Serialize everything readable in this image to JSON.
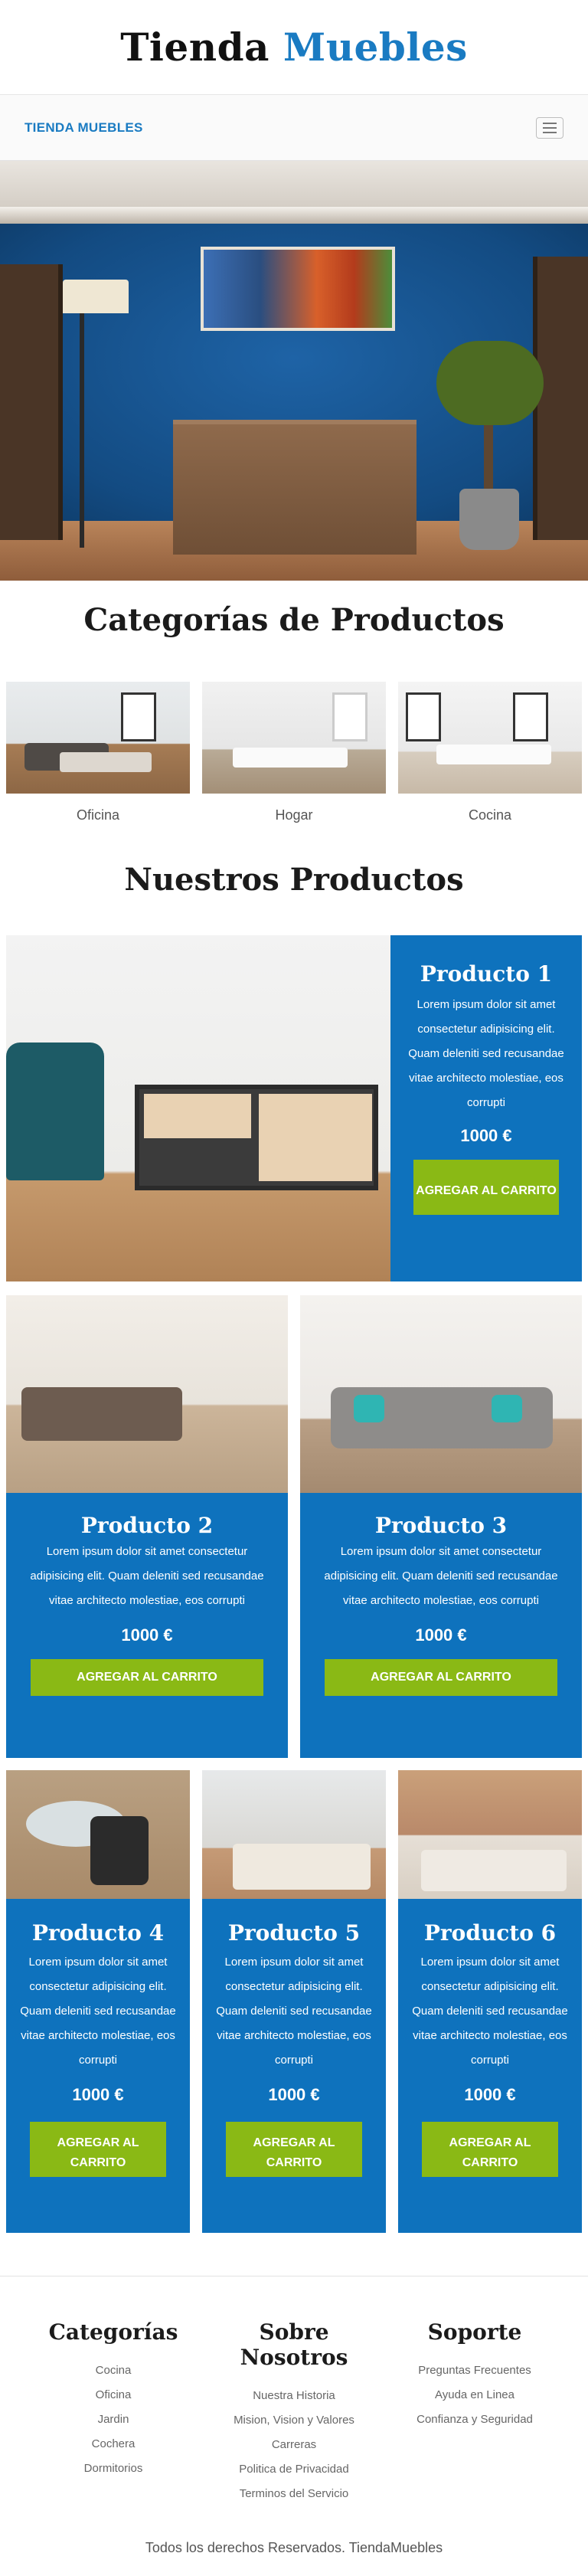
{
  "site": {
    "title_part1": "Tienda",
    "title_part2": "Muebles",
    "brand": "TIENDA MUEBLES"
  },
  "categories_section": {
    "title": "Categorías de Productos",
    "items": [
      {
        "label": "Oficina"
      },
      {
        "label": "Hogar"
      },
      {
        "label": "Cocina"
      }
    ]
  },
  "products_section": {
    "title": "Nuestros Productos",
    "add_to_cart_label": "AGREGAR AL CARRITO",
    "items": [
      {
        "name": "Producto 1",
        "desc": "Lorem ipsum dolor sit amet consectetur adipisicing elit. Quam deleniti sed recusandae vitae architecto molestiae, eos corrupti",
        "price": "1000 €"
      },
      {
        "name": "Producto 2",
        "desc": "Lorem ipsum dolor sit amet consectetur adipisicing elit. Quam deleniti sed recusandae vitae architecto molestiae, eos corrupti",
        "price": "1000 €"
      },
      {
        "name": "Producto 3",
        "desc": "Lorem ipsum dolor sit amet consectetur adipisicing elit. Quam deleniti sed recusandae vitae architecto molestiae, eos corrupti",
        "price": "1000 €"
      },
      {
        "name": "Producto 4",
        "desc": "Lorem ipsum dolor sit amet consectetur adipisicing elit. Quam deleniti sed recusandae vitae architecto molestiae, eos corrupti",
        "price": "1000 €"
      },
      {
        "name": "Producto 5",
        "desc": "Lorem ipsum dolor sit amet consectetur adipisicing elit. Quam deleniti sed recusandae vitae architecto molestiae, eos corrupti",
        "price": "1000 €"
      },
      {
        "name": "Producto 6",
        "desc": "Lorem ipsum dolor sit amet consectetur adipisicing elit. Quam deleniti sed recusandae vitae architecto molestiae, eos corrupti",
        "price": "1000 €"
      }
    ]
  },
  "footer": {
    "columns": [
      {
        "title": "Categorías",
        "links": [
          "Cocina",
          "Oficina",
          "Jardin",
          "Cochera",
          "Dormitorios"
        ]
      },
      {
        "title": "Sobre Nosotros",
        "links": [
          "Nuestra Historia",
          "Mision, Vision y Valores",
          "Carreras",
          "Politica de Privacidad",
          "Terminos del Servicio"
        ]
      },
      {
        "title": "Soporte",
        "links": [
          "Preguntas Frecuentes",
          "Ayuda en Linea",
          "Confianza y Seguridad"
        ]
      }
    ],
    "copyright": "Todos los derechos Reservados. TiendaMuebles"
  },
  "colors": {
    "accent_blue": "#1a7bc2",
    "card_blue": "#0e72bd",
    "button_green": "#8ab915"
  },
  "icons": {
    "menu_toggle": "hamburger-menu-icon"
  }
}
